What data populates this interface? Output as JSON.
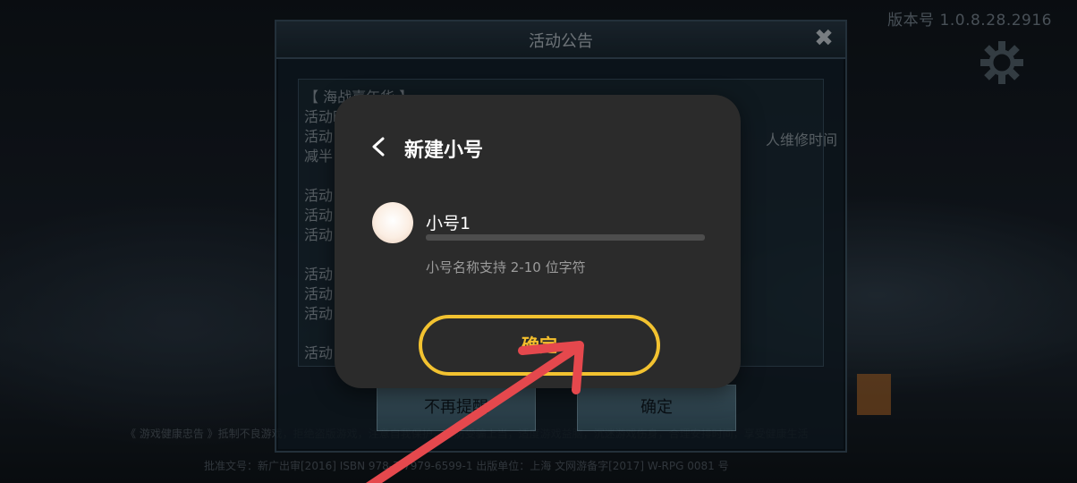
{
  "game": {
    "version_label": "版本号 1.0.8.28.2916",
    "announcement": {
      "title": "活动公告",
      "close_glyph": "✖",
      "lines": [
        "【 海战嘉年华 】",
        "活动时",
        "活动",
        "减半",
        "活动",
        "活动",
        "活动",
        "活动",
        "活动",
        "活动",
        "活动"
      ],
      "right_fragment": "人维修时间",
      "buttons": {
        "dont_remind": "不再提醒",
        "confirm": "确定"
      }
    },
    "footer_notice": "《 游戏健康忠告 》抵制不良游戏，拒绝盗版游戏，注意自我保护，谨防受骗上当，适度游戏益脑，沉迷游戏伤身，合理安排时间，享受健康生活",
    "footer_license": "批准文号：新广出审[2016] ISBN 978-7-7979-6599-1 出版单位：上海 文网游备字[2017] W-RPG 0081 号"
  },
  "dialog": {
    "title": "新建小号",
    "back_icon": "chevron-left-icon",
    "account_name": "小号1",
    "hint": "小号名称支持 2-10 位字符",
    "confirm_label": "确定"
  },
  "colors": {
    "dialog_bg": "#2b2b2b",
    "confirm_highlight": "#f2c230",
    "arrow": "#e5484d"
  }
}
